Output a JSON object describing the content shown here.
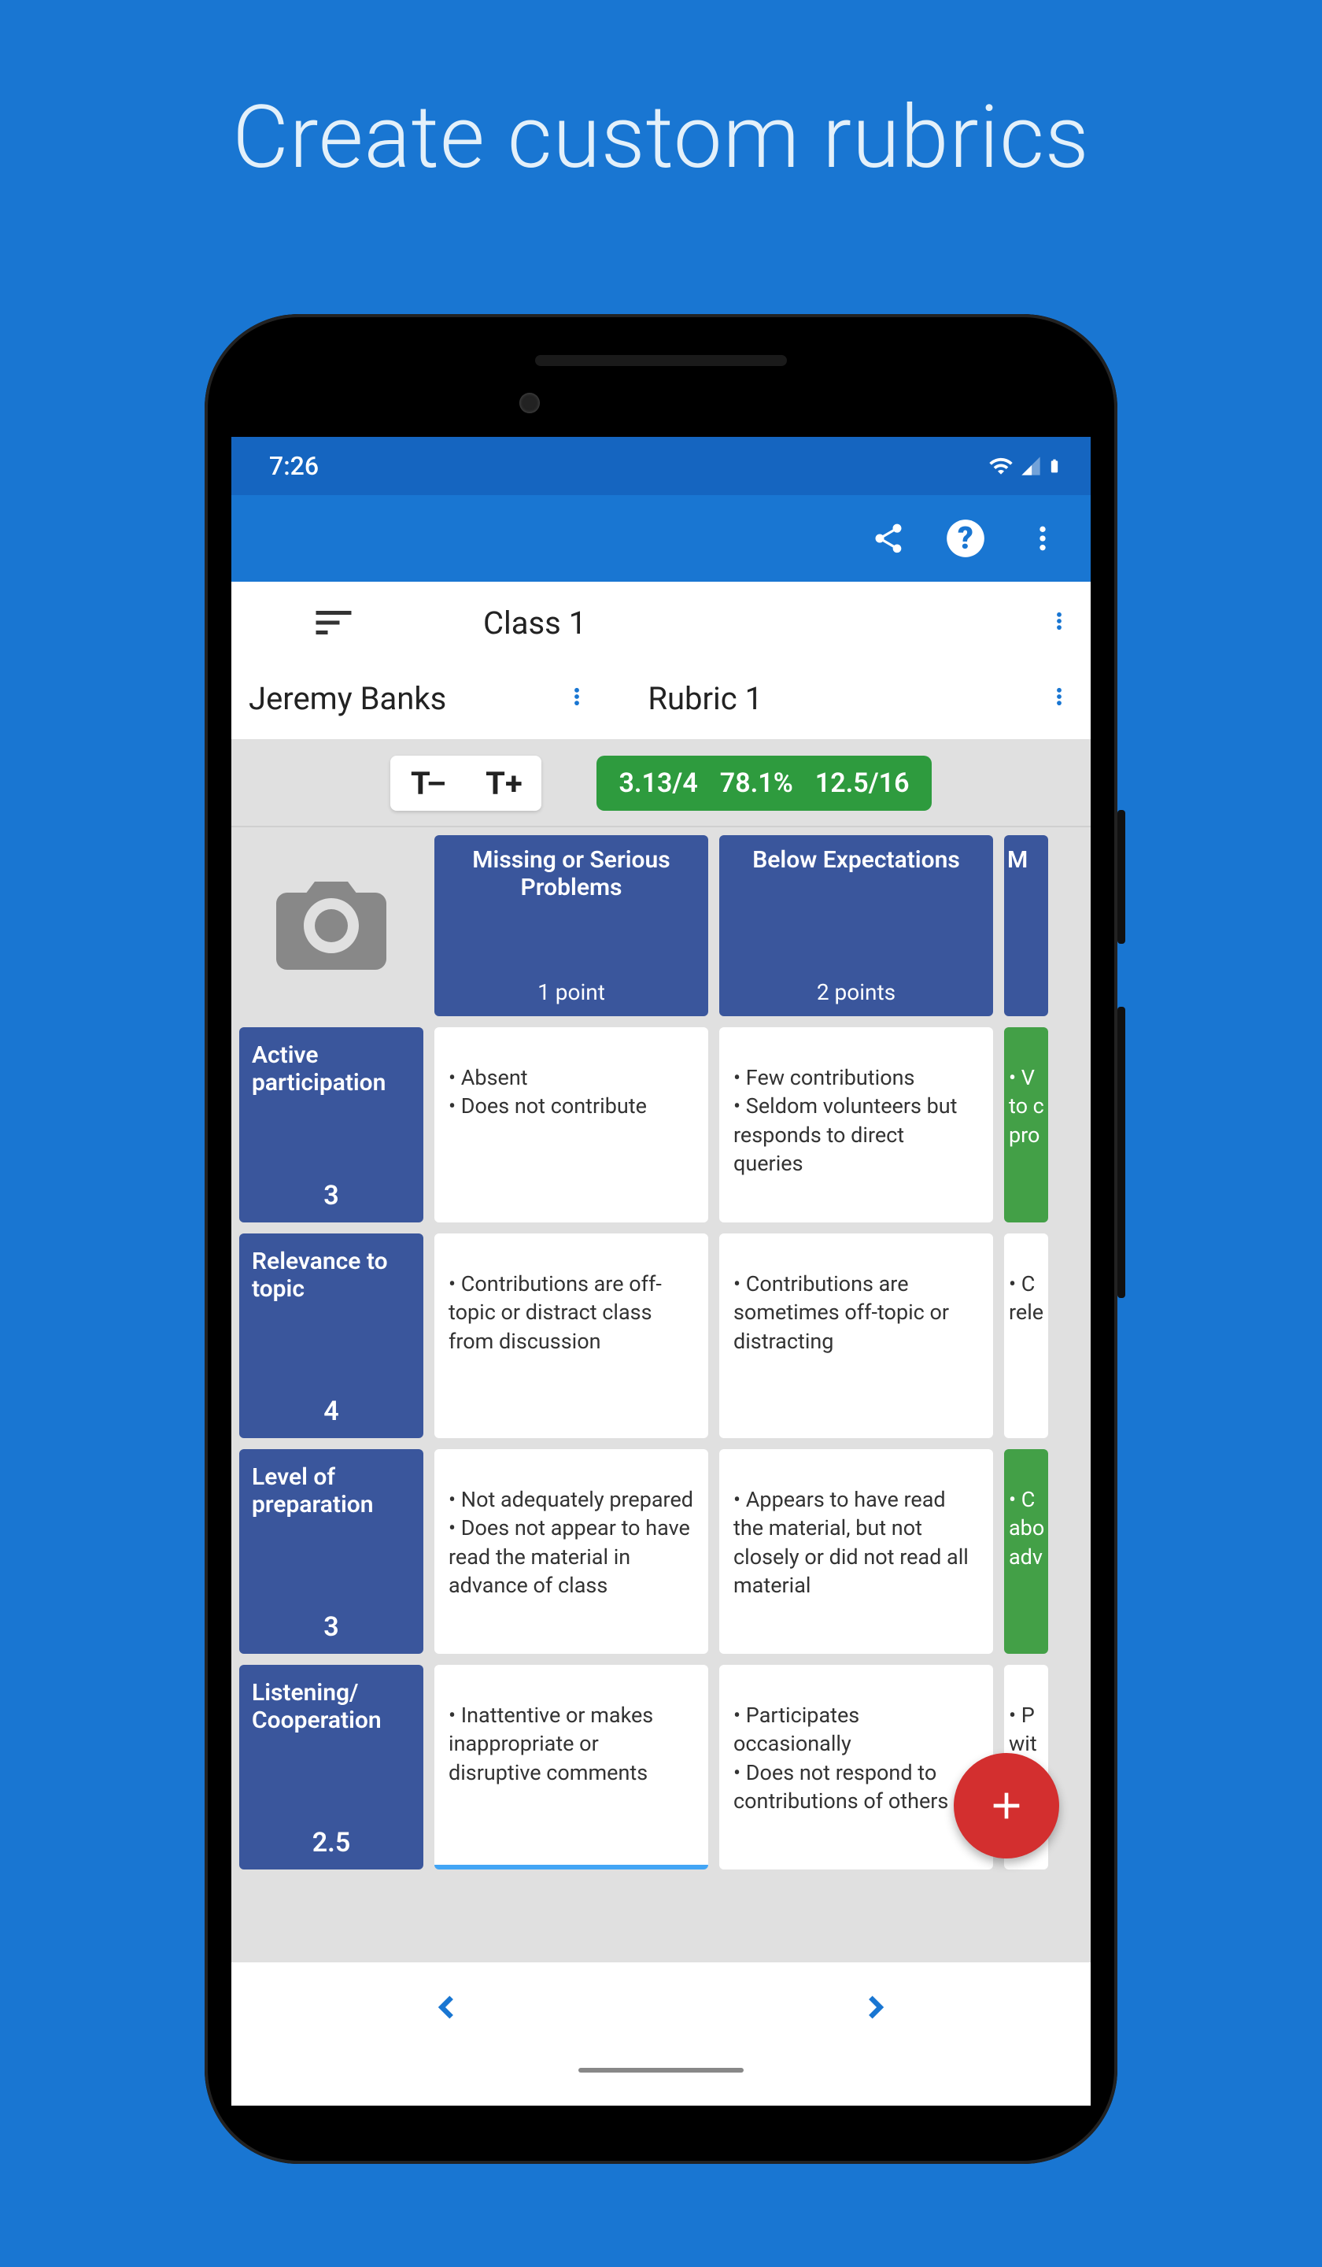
{
  "promo": {
    "title": "Create custom rubrics"
  },
  "status": {
    "time": "7:26"
  },
  "selector": {
    "class_label": "Class 1",
    "student_name": "Jeremy Banks",
    "rubric_name": "Rubric 1"
  },
  "text_size": {
    "minus": "T–",
    "plus": "T+"
  },
  "score": {
    "avg": "3.13/4",
    "pct": "78.1%",
    "total": "12.5/16"
  },
  "columns": [
    {
      "title": "Missing or Serious Problems",
      "points": "1 point"
    },
    {
      "title": "Below Expectations",
      "points": "2 points"
    },
    {
      "title": "M",
      "points": ""
    }
  ],
  "rows": [
    {
      "title": "Active participation",
      "score": "3",
      "cells": [
        "• Absent\n• Does not contribute",
        "• Few contributions\n• Seldom volunteers but responds to direct queries",
        "• V\nto c\npro"
      ],
      "peek_sel": true
    },
    {
      "title": "Relevance to topic",
      "score": "4",
      "cells": [
        "• Contributions are off-topic or distract class from discussion",
        "• Contributions are sometimes off-topic or distracting",
        "• C\nrele"
      ],
      "peek_sel": false
    },
    {
      "title": "Level of preparation",
      "score": "3",
      "cells": [
        "• Not adequately prepared\n• Does not appear to have read the material in advance of class",
        "• Appears to have read the material, but not closely or did not read all material",
        "• C\nabo\nadv"
      ],
      "peek_sel": true
    },
    {
      "title": "Listening/ Cooperation",
      "score": "2.5",
      "cells": [
        "• Inattentive or makes inappropriate or disruptive comments",
        "• Participates occasionally\n• Does not respond to contributions of others",
        "• P\nwit\n• Li\ncor"
      ],
      "peek_sel": false,
      "underline_first": true
    }
  ]
}
